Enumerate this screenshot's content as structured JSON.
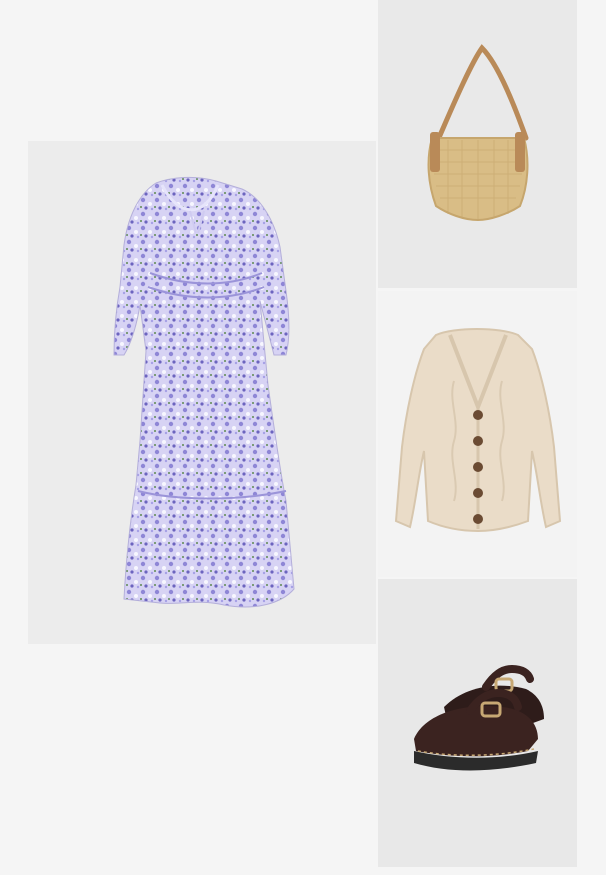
{
  "outfit": {
    "items": [
      {
        "name": "floral-maxi-dress",
        "color": "#b7b1e3",
        "accent": "#7f78c9"
      },
      {
        "name": "straw-shoulder-bag",
        "color": "#d9bd86",
        "strap": "#b98a58"
      },
      {
        "name": "cable-knit-cardigan",
        "color": "#eadcc8",
        "buttons": "#6b4b33"
      },
      {
        "name": "mary-jane-shoes",
        "color": "#3b2320",
        "sole": "#2b2b2b",
        "buckle": "#c7a874"
      }
    ]
  }
}
